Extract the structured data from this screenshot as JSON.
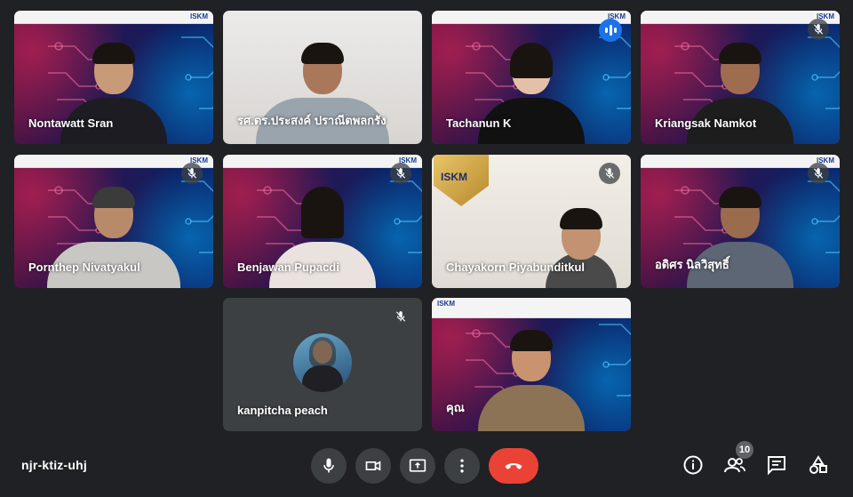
{
  "meeting": {
    "code": "njr-ktiz-uhj",
    "participant_count": "10"
  },
  "banner": {
    "logo_text": "ISKM"
  },
  "participants": [
    {
      "name": "Nontawatt Sran",
      "muted": false,
      "speaking": false,
      "background": "tech"
    },
    {
      "name": "รศ.ดร.ประสงค์ ปราณีตพลกรัง",
      "muted": false,
      "speaking": false,
      "background": "office"
    },
    {
      "name": "Tachanun K",
      "muted": false,
      "speaking": true,
      "background": "tech"
    },
    {
      "name": "Kriangsak Namkot",
      "muted": true,
      "speaking": false,
      "background": "tech"
    },
    {
      "name": "Pornthep Nivatyakul",
      "muted": true,
      "speaking": false,
      "background": "tech"
    },
    {
      "name": "Benjawan Pupacdi",
      "muted": true,
      "speaking": false,
      "background": "tech"
    },
    {
      "name": "Chayakorn Piyabunditkul",
      "muted": true,
      "speaking": false,
      "background": "room"
    },
    {
      "name": "อดิศร นิลวิสุทธิ์",
      "muted": true,
      "speaking": false,
      "background": "tech"
    },
    {
      "name": "kanpitcha peach",
      "muted": true,
      "speaking": false,
      "background": "avatar"
    },
    {
      "name": "คุณ",
      "muted": false,
      "speaking": false,
      "background": "tech"
    }
  ],
  "colors": {
    "page_bg": "#202124",
    "control_bg": "#3c4043",
    "end_call": "#ea4335",
    "active_border": "#8ab4f8",
    "speaking": "#1a73e8"
  },
  "icons": {
    "microphone": "microphone-icon",
    "camera": "camera-icon",
    "present": "present-screen-icon",
    "more": "more-options-icon",
    "end_call": "end-call-icon",
    "info": "info-icon",
    "people": "people-icon",
    "chat": "chat-icon",
    "activities": "activities-icon"
  }
}
